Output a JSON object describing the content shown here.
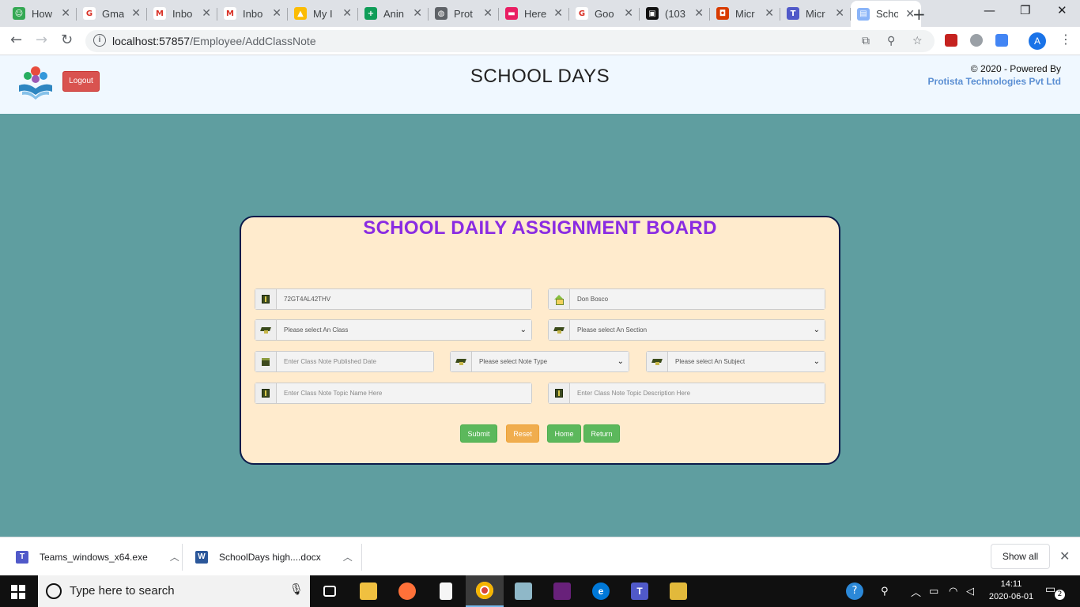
{
  "browser": {
    "tabs": [
      {
        "title": "How",
        "fav_color": "#34a853",
        "fav_glyph": "☺"
      },
      {
        "title": "Gma",
        "fav_color": "#ffffff",
        "fav_glyph": "G"
      },
      {
        "title": "Inbo",
        "fav_color": "#ffffff",
        "fav_glyph": "M"
      },
      {
        "title": "Inbo",
        "fav_color": "#ffffff",
        "fav_glyph": "M"
      },
      {
        "title": "My I",
        "fav_color": "#fbbc04",
        "fav_glyph": "▲"
      },
      {
        "title": "Anin",
        "fav_color": "#0f9d58",
        "fav_glyph": "+"
      },
      {
        "title": "Prot",
        "fav_color": "#5f6368",
        "fav_glyph": "◍"
      },
      {
        "title": "Here",
        "fav_color": "#e91e63",
        "fav_glyph": "▬"
      },
      {
        "title": "Goo",
        "fav_color": "#ffffff",
        "fav_glyph": "G"
      },
      {
        "title": "(103",
        "fav_color": "#111111",
        "fav_glyph": "▣"
      },
      {
        "title": "Micr",
        "fav_color": "#d83b01",
        "fav_glyph": "◘"
      },
      {
        "title": "Micr",
        "fav_color": "#5059c9",
        "fav_glyph": "T"
      },
      {
        "title": "Scho",
        "fav_color": "#8ab4f8",
        "fav_glyph": "▤",
        "active": true
      }
    ],
    "url_host": "localhost:57857",
    "url_path": "/Employee/AddClassNote",
    "profile_initial": "A"
  },
  "header": {
    "logout_label": "Logout",
    "site_title": "SCHOOL DAYS",
    "powered_line": "© 2020 - Powered By",
    "company": "Protista Technologies Pvt Ltd"
  },
  "board": {
    "title": "SCHOOL DAILY ASSIGNMENT BOARD",
    "employee_code_value": "72GT4AL42THV",
    "school_name_value": "Don Bosco",
    "class_select": "Please select An Class",
    "section_select": "Please select An Section",
    "date_placeholder": "Enter Class Note Published  Date",
    "note_type_select": "Please select Note Type",
    "subject_select": "Please select An Subject",
    "topic_name_placeholder": "Enter Class Note  Topic Name Here",
    "topic_desc_placeholder": "Enter Class Note  Topic Description Here",
    "submit_label": "Submit",
    "reset_label": "Reset",
    "home_label": "Home",
    "return_label": "Return"
  },
  "downloads": {
    "items": [
      {
        "name": "Teams_windows_x64.exe",
        "icon_color": "#5059c9",
        "glyph": "T"
      },
      {
        "name": "SchoolDays high....docx",
        "icon_color": "#2b579a",
        "glyph": "W"
      }
    ],
    "show_all": "Show all"
  },
  "taskbar": {
    "search_text": "Type here to search",
    "time": "14:11",
    "date": "2020-06-01",
    "notification_count": "2"
  }
}
